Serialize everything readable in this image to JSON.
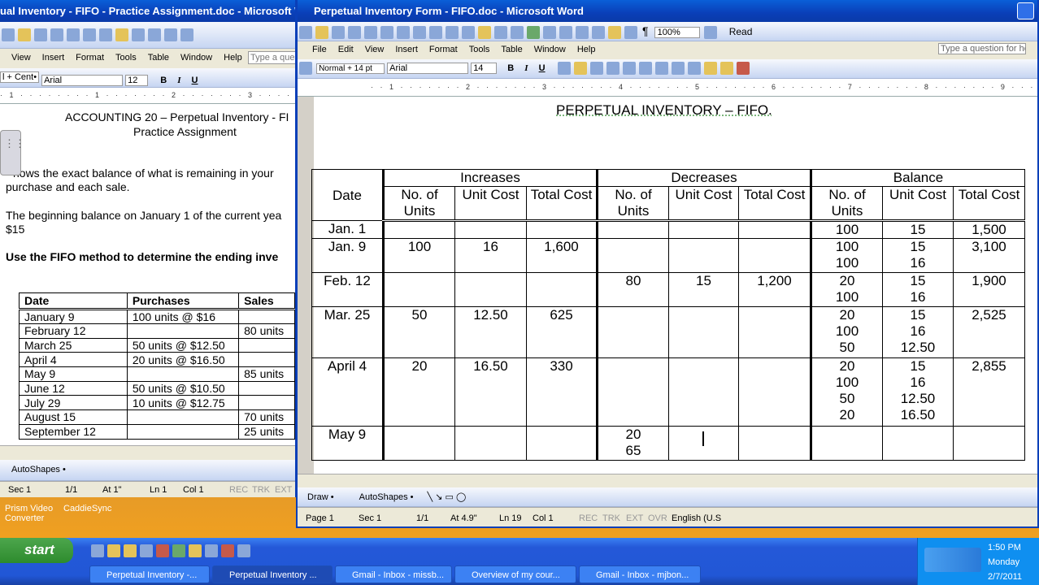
{
  "desktop": {
    "icon1": "Prism Video Converter",
    "icon2": "CaddieSync"
  },
  "back": {
    "title": "ual Inventory - FIFO - Practice Assignment.doc - Microsoft Word",
    "menu": [
      "View",
      "Insert",
      "Format",
      "Tools",
      "Table",
      "Window",
      "Help"
    ],
    "ask": "Type a ques",
    "style": "l + Cent•",
    "font": "Arial",
    "size": "12",
    "line1": "ACCOUNTING 20 – Perpetual Inventory - FI",
    "line2": "Practice Assignment",
    "para1a": "hows the exact balance of what is remaining in your",
    "para1b": "purchase and each sale.",
    "para2a": "The beginning balance on January 1 of the current yea",
    "para2b": "$15",
    "para3": "Use the FIFO method to determine the ending inve",
    "table_headers": [
      "Date",
      "Purchases",
      "Sales"
    ],
    "table_rows": [
      [
        "January 9",
        "100 units @ $16",
        ""
      ],
      [
        "February 12",
        "",
        "80 units"
      ],
      [
        "March 25",
        "50 units @ $12.50",
        ""
      ],
      [
        "April 4",
        "20 units @ $16.50",
        ""
      ],
      [
        "May 9",
        "",
        "85 units"
      ],
      [
        "June 12",
        "50 units @ $10.50",
        ""
      ],
      [
        "July 29",
        "10 units @ $12.75",
        ""
      ],
      [
        "August 15",
        "",
        "70 units"
      ],
      [
        "September 12",
        "",
        "25 units"
      ]
    ],
    "draw": "AutoShapes •",
    "status": {
      "sec": "Sec 1",
      "page": "1/1",
      "at": "At 1\"",
      "ln": "Ln 1",
      "col": "Col 1",
      "rec": "REC",
      "trk": "TRK",
      "ext": "EXT"
    }
  },
  "front": {
    "title": "Perpetual Inventory Form - FIFO.doc - Microsoft Word",
    "zoom": "100%",
    "read": "Read",
    "menu": [
      "File",
      "Edit",
      "View",
      "Insert",
      "Format",
      "Tools",
      "Table",
      "Window",
      "Help"
    ],
    "ask": "Type a question for help",
    "style": "Normal + 14 pt",
    "font": "Arial",
    "size": "14",
    "doc_title": "PERPETUAL INVENTORY – FIFO.",
    "groups": [
      "Increases",
      "Decreases",
      "Balance"
    ],
    "date_header": "Date",
    "col_no": "No. of Units",
    "col_uc": "Unit Cost",
    "col_tc": "Total Cost",
    "rows": [
      {
        "date": "Jan. 1",
        "inc": [
          "",
          "",
          ""
        ],
        "dec": [
          "",
          "",
          ""
        ],
        "bal": [
          "100",
          "15",
          "1,500"
        ]
      },
      {
        "date": "Jan. 9",
        "inc": [
          "100",
          "16",
          "1,600"
        ],
        "dec": [
          "",
          "",
          ""
        ],
        "bal": [
          "100\n100",
          "15\n16",
          "3,100"
        ]
      },
      {
        "date": "Feb. 12",
        "inc": [
          "",
          "",
          ""
        ],
        "dec": [
          "80",
          "15",
          "1,200"
        ],
        "bal": [
          "20\n100",
          "15\n16",
          "1,900"
        ]
      },
      {
        "date": "Mar. 25",
        "inc": [
          "50",
          "12.50",
          "625"
        ],
        "dec": [
          "",
          "",
          ""
        ],
        "bal": [
          "20\n100\n50",
          "15\n16\n12.50",
          "2,525"
        ]
      },
      {
        "date": "April 4",
        "inc": [
          "20",
          "16.50",
          "330"
        ],
        "dec": [
          "",
          "",
          ""
        ],
        "bal": [
          "20\n100\n50\n20",
          "15\n16\n12.50\n16.50",
          "2,855"
        ]
      },
      {
        "date": "May 9",
        "inc": [
          "",
          "",
          ""
        ],
        "dec": [
          "20\n65",
          "",
          ""
        ],
        "bal": [
          "",
          "",
          ""
        ]
      }
    ],
    "draw": "Draw •",
    "autoshapes": "AutoShapes •",
    "status": {
      "page": "Page 1",
      "sec": "Sec 1",
      "pages": "1/1",
      "at": "At 4.9\"",
      "ln": "Ln 19",
      "col": "Col 1",
      "rec": "REC",
      "trk": "TRK",
      "ext": "EXT",
      "ovr": "OVR",
      "lang": "English (U.S"
    }
  },
  "taskbar": {
    "start": "start",
    "tasks": [
      "Perpetual Inventory -...",
      "Perpetual Inventory ...",
      "Gmail - Inbox - missb...",
      "Overview of my cour...",
      "Gmail - Inbox - mjbon..."
    ],
    "time": "1:50 PM",
    "day": "Monday",
    "date": "2/7/2011"
  }
}
